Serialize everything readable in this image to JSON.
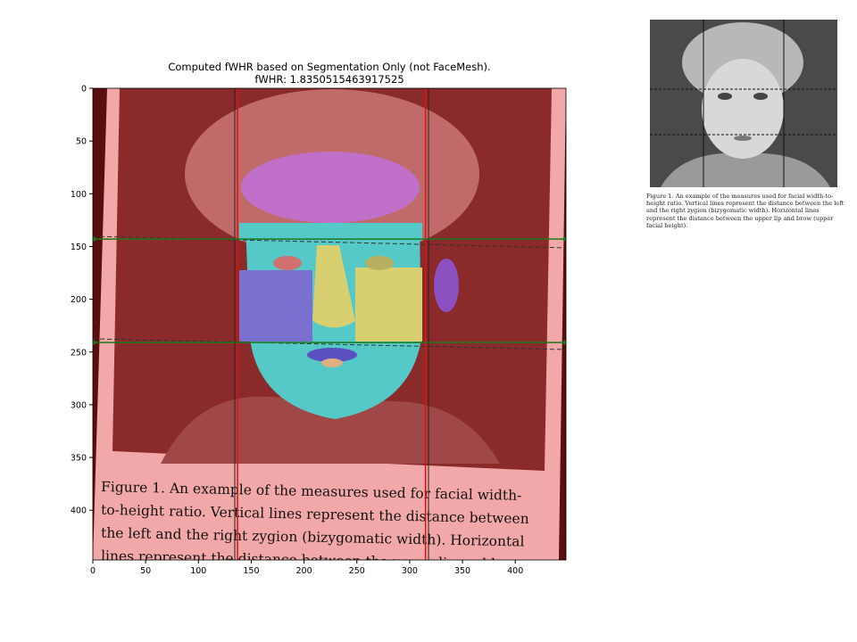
{
  "chart_data": {
    "type": "image-overlay",
    "title_line1": "Computed fWHR based on Segmentation Only (not FaceMesh).",
    "title_line2": "fWHR: 1.8350515463917525",
    "xlim": [
      0,
      448
    ],
    "ylim": [
      448,
      0
    ],
    "xticks": [
      0,
      50,
      100,
      150,
      200,
      250,
      300,
      350,
      400
    ],
    "yticks": [
      0,
      50,
      100,
      150,
      200,
      250,
      300,
      350,
      400
    ],
    "vertical_lines_x": [
      137,
      315
    ],
    "horizontal_lines_y": [
      143,
      241
    ],
    "colors": {
      "vertical": "#e01010",
      "horizontal": "#1a7a1a",
      "background_mask": "#8b1a1a",
      "skin": "#55c8c8",
      "hair": "#c070c8",
      "eyes_region": "#d8d070",
      "cheek": "#7a70d0"
    },
    "image_caption_lines": [
      "Figure 1. An example of the measures used for facial width-",
      "to-height ratio. Vertical lines represent the distance between",
      "the left and the right zygion (bizygomatic width). Horizontal",
      "lines represent the distance between the upper lip and brow",
      "(upper facial height)."
    ]
  },
  "reference": {
    "caption": "Figure 1. An example of the measures used for facial width-to-height ratio. Vertical lines represent the distance between the left and the right zygion (bizygomatic width). Horizontal lines represent the distance between the upper lip and brow (upper facial height)."
  }
}
